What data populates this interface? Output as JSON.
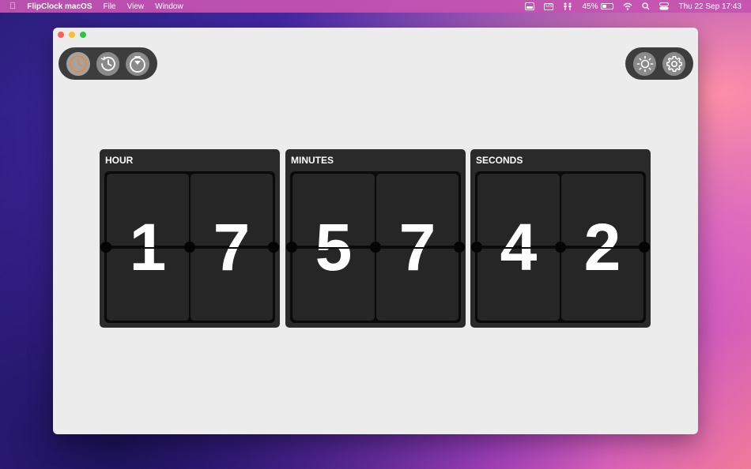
{
  "menubar": {
    "app_name": "FlipClock macOS",
    "menus": [
      "File",
      "View",
      "Window"
    ],
    "keyboard_layout": "US",
    "battery_percent": "45%",
    "battery_level": 0.45,
    "datetime": "Thu 22 Sep  17:43"
  },
  "toolbar": {
    "left_buttons": [
      "clock-icon",
      "history-icon",
      "timer-icon"
    ],
    "right_buttons": [
      "brightness-icon",
      "gear-icon"
    ],
    "accent_color": "#e8893a"
  },
  "clock": {
    "panels": [
      {
        "label": "HOUR",
        "digits": [
          "1",
          "7"
        ]
      },
      {
        "label": "MINUTES",
        "digits": [
          "5",
          "7"
        ]
      },
      {
        "label": "SECONDS",
        "digits": [
          "4",
          "2"
        ]
      }
    ]
  }
}
